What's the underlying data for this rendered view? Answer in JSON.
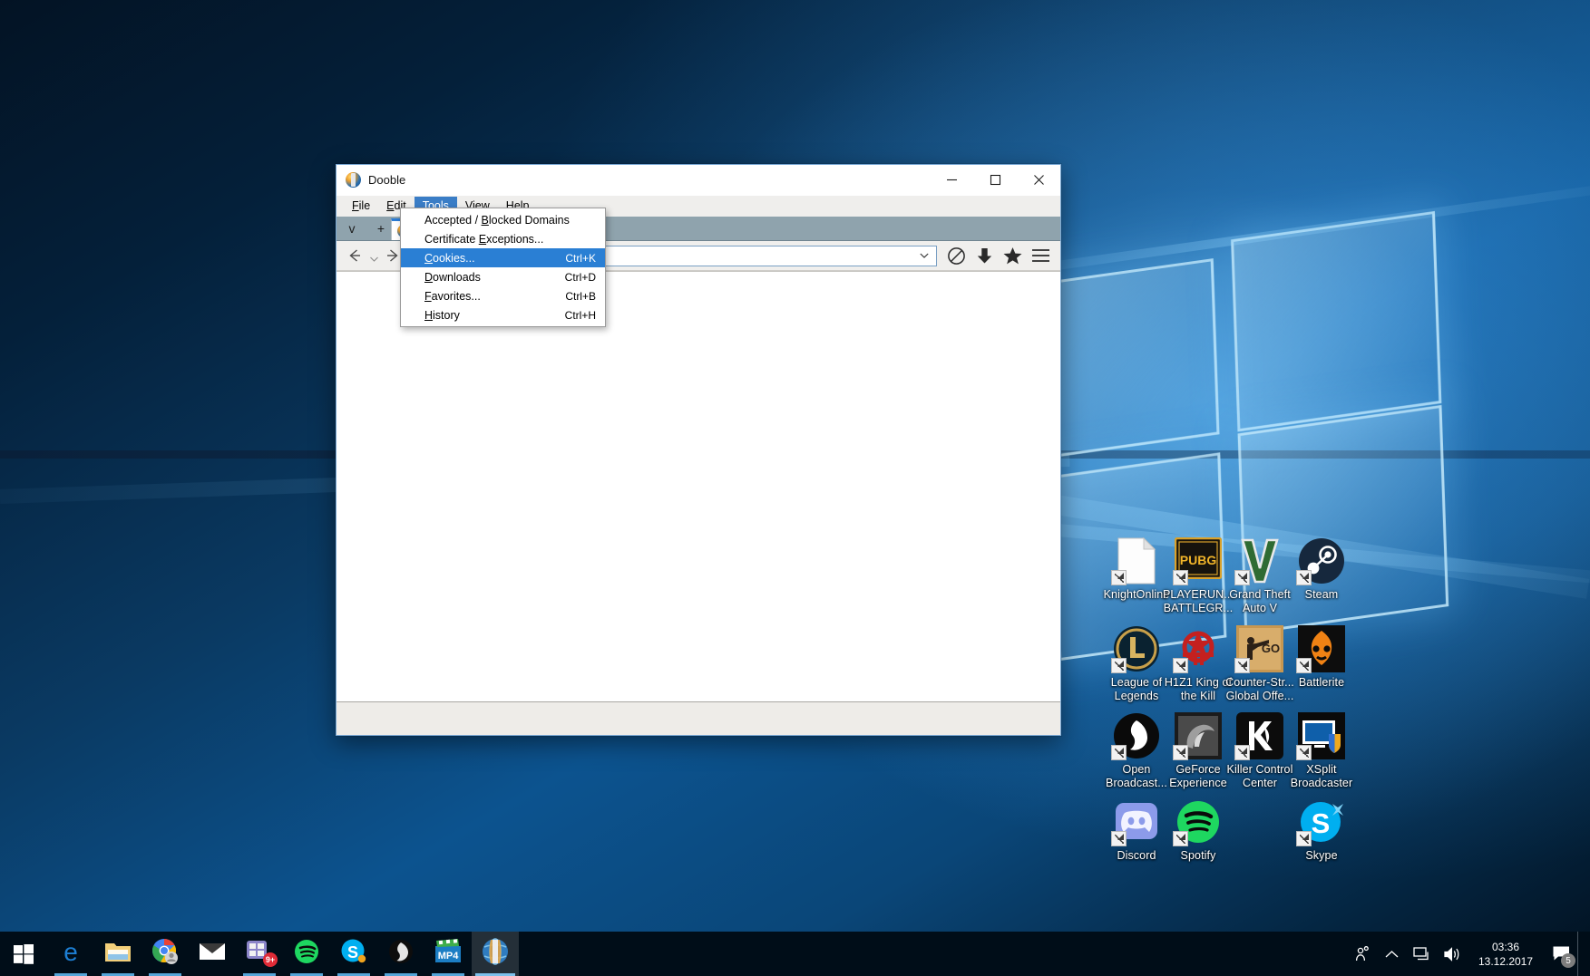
{
  "window": {
    "title": "Dooble",
    "icon": "dooble-globe-icon",
    "minimize_label": "Minimize",
    "maximize_label": "Maximize",
    "close_label": "Close"
  },
  "menubar": {
    "items": [
      {
        "label": "File",
        "accel": "F",
        "active": false
      },
      {
        "label": "Edit",
        "accel": "E",
        "active": false
      },
      {
        "label": "Tools",
        "accel": "T",
        "active": true
      },
      {
        "label": "View",
        "accel": "V",
        "active": false
      },
      {
        "label": "Help",
        "accel": "H",
        "active": false
      }
    ]
  },
  "tools_menu": {
    "items": [
      {
        "label": "Accepted / Blocked Domains",
        "shortcut": "",
        "selected": false
      },
      {
        "label": "Certificate Exceptions...",
        "shortcut": "",
        "selected": false
      },
      {
        "label": "Cookies...",
        "shortcut": "Ctrl+K",
        "selected": true
      },
      {
        "label": "Downloads",
        "shortcut": "Ctrl+D",
        "selected": false
      },
      {
        "label": "Favorites...",
        "shortcut": "Ctrl+B",
        "selected": false
      },
      {
        "label": "History",
        "shortcut": "Ctrl+H",
        "selected": false
      }
    ]
  },
  "tabbar": {
    "list_tabs_label": "v",
    "new_tab_label": "+",
    "tabs": [
      {
        "title": "",
        "favicon": "dooble-globe-icon",
        "active": true
      }
    ]
  },
  "navbar": {
    "back_label": "Back",
    "back_history_label": "Back history",
    "forward_label": "Forward",
    "url_value": "",
    "url_placeholder": "",
    "url_dropdown_label": "Show history",
    "tools": [
      {
        "name": "block-icon",
        "label": "Blocked"
      },
      {
        "name": "download-icon",
        "label": "Downloads"
      },
      {
        "name": "star-icon",
        "label": "Favorites"
      },
      {
        "name": "hamburger-icon",
        "label": "Menu"
      }
    ]
  },
  "desktop": {
    "icons": [
      {
        "label": "KnightOnline",
        "icon": "file-document-icon",
        "col": 0,
        "row": 0
      },
      {
        "label": "PLAYERUN...\nBATTLEGR...",
        "icon": "pubg-icon",
        "col": 1,
        "row": 0
      },
      {
        "label": "Grand Theft\nAuto V",
        "icon": "gta-v-icon",
        "col": 2,
        "row": 0
      },
      {
        "label": "Steam",
        "icon": "steam-icon",
        "col": 3,
        "row": 0
      },
      {
        "label": "League of\nLegends",
        "icon": "league-of-legends-icon",
        "col": 0,
        "row": 1
      },
      {
        "label": "H1Z1 King of\nthe Kill",
        "icon": "h1z1-icon",
        "col": 1,
        "row": 1
      },
      {
        "label": "Counter-Str...\nGlobal Offe...",
        "icon": "csgo-icon",
        "col": 2,
        "row": 1
      },
      {
        "label": "Battlerite",
        "icon": "battlerite-icon",
        "col": 3,
        "row": 1
      },
      {
        "label": "Open\nBroadcast...",
        "icon": "obs-icon",
        "col": 0,
        "row": 2
      },
      {
        "label": "GeForce\nExperience",
        "icon": "geforce-icon",
        "col": 1,
        "row": 2
      },
      {
        "label": "Killer Control\nCenter",
        "icon": "killer-control-icon",
        "col": 2,
        "row": 2
      },
      {
        "label": "XSplit\nBroadcaster",
        "icon": "xsplit-icon",
        "col": 3,
        "row": 2
      },
      {
        "label": "Discord",
        "icon": "discord-icon",
        "col": 0,
        "row": 3
      },
      {
        "label": "Spotify",
        "icon": "spotify-icon",
        "col": 1,
        "row": 3
      },
      {
        "label": "Skype",
        "icon": "skype-icon",
        "col": 3,
        "row": 3
      }
    ]
  },
  "taskbar": {
    "start_label": "Start",
    "items": [
      {
        "name": "edge-icon",
        "label": "Microsoft Edge",
        "state": "running"
      },
      {
        "name": "file-explorer-icon",
        "label": "File Explorer",
        "state": "running"
      },
      {
        "name": "chrome-icon",
        "label": "Google Chrome",
        "state": "running"
      },
      {
        "name": "mail-icon",
        "label": "Mail",
        "state": "none"
      },
      {
        "name": "photos-icon",
        "label": "Photos",
        "state": "running",
        "badge": "9+"
      },
      {
        "name": "spotify-icon",
        "label": "Spotify",
        "state": "running"
      },
      {
        "name": "skype-icon",
        "label": "Skype",
        "state": "running"
      },
      {
        "name": "obs-icon",
        "label": "OBS",
        "state": "running"
      },
      {
        "name": "mp4-player-icon",
        "label": "MP4 Player",
        "state": "running"
      },
      {
        "name": "dooble-icon",
        "label": "Dooble",
        "state": "active"
      }
    ],
    "tray": {
      "icons": [
        {
          "name": "people-icon",
          "label": "People"
        },
        {
          "name": "chevron-up-icon",
          "label": "Show hidden icons"
        },
        {
          "name": "network-icon",
          "label": "Network"
        },
        {
          "name": "volume-icon",
          "label": "Volume"
        }
      ],
      "clock": {
        "time": "03:36",
        "date": "13.12.2017"
      },
      "action_center": {
        "name": "action-center-icon",
        "badge": "5"
      },
      "show_desktop_label": "Show desktop"
    }
  },
  "colors": {
    "accent": "#2a7fd4",
    "menu_highlight": "#3a7dc6",
    "tabbar_bg": "#8fa3ad",
    "toolbar_bg": "#f0efed",
    "taskbar_bg": "#000d18",
    "tab_top_accent": "#2a7bd4"
  }
}
